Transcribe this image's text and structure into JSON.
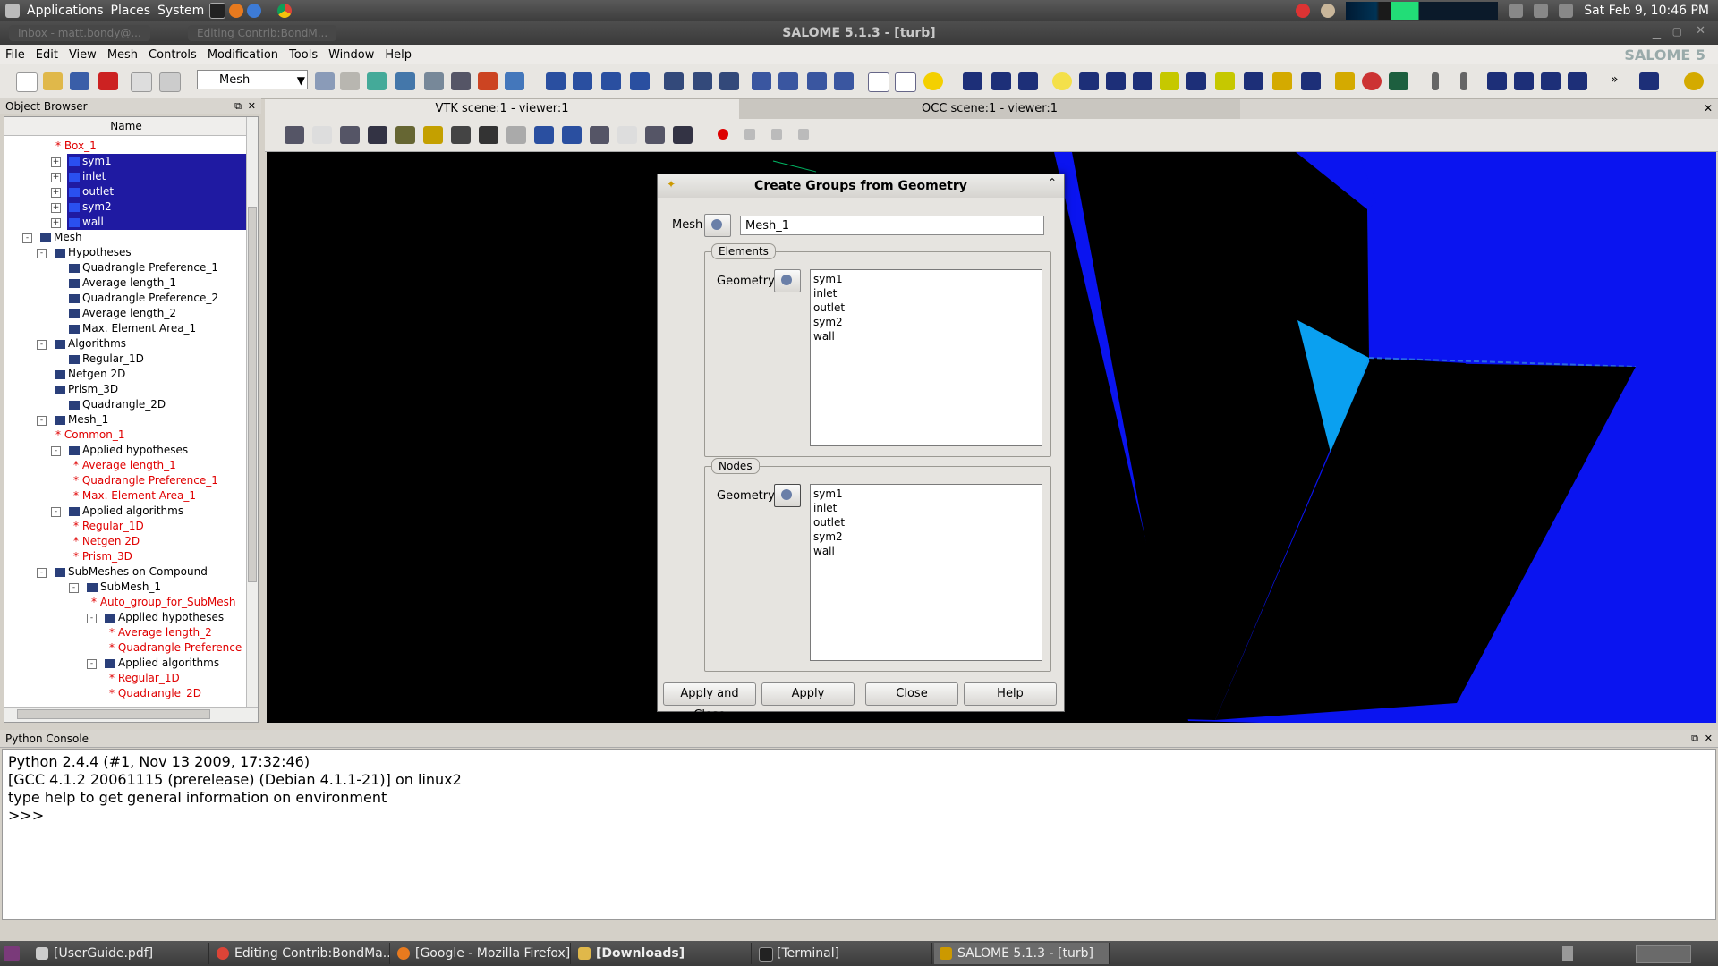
{
  "top_panel": {
    "menus": [
      "Applications",
      "Places",
      "System"
    ],
    "clock": "Sat Feb  9, 10:46 PM"
  },
  "window": {
    "title": "SALOME 5.1.3 - [turb]",
    "ghost_tabs": [
      "Inbox - matt.bondy@...",
      "Editing Contrib:BondM..."
    ]
  },
  "menubar": [
    "File",
    "Edit",
    "View",
    "Mesh",
    "Controls",
    "Modification",
    "Tools",
    "Window",
    "Help"
  ],
  "toolbar": {
    "module_combo": "Mesh"
  },
  "object_browser": {
    "title": "Object Browser",
    "column": "Name",
    "items": [
      {
        "label": "* Box_1",
        "indent": 64,
        "red": true
      },
      {
        "label": "sym1",
        "indent": 80,
        "selected": true,
        "expand": "+"
      },
      {
        "label": "inlet",
        "indent": 80,
        "selected": true,
        "expand": "+"
      },
      {
        "label": "outlet",
        "indent": 80,
        "selected": true,
        "expand": "+"
      },
      {
        "label": "sym2",
        "indent": 80,
        "selected": true,
        "expand": "+"
      },
      {
        "label": "wall",
        "indent": 80,
        "selected": true,
        "expand": "+"
      },
      {
        "label": "Mesh",
        "indent": 48,
        "expand": "-"
      },
      {
        "label": "Hypotheses",
        "indent": 64,
        "expand": "-"
      },
      {
        "label": "Quadrangle Preference_1",
        "indent": 80
      },
      {
        "label": "Average length_1",
        "indent": 80
      },
      {
        "label": "Quadrangle Preference_2",
        "indent": 80
      },
      {
        "label": "Average length_2",
        "indent": 80
      },
      {
        "label": "Max. Element Area_1",
        "indent": 80
      },
      {
        "label": "Algorithms",
        "indent": 64,
        "expand": "-"
      },
      {
        "label": "Regular_1D",
        "indent": 80
      },
      {
        "label": "Netgen 2D",
        "indent": 64
      },
      {
        "label": "Prism_3D",
        "indent": 64
      },
      {
        "label": "Quadrangle_2D",
        "indent": 80
      },
      {
        "label": "Mesh_1",
        "indent": 64,
        "expand": "-"
      },
      {
        "label": "* Common_1",
        "indent": 64,
        "red": true
      },
      {
        "label": "Applied hypotheses",
        "indent": 80,
        "expand": "-"
      },
      {
        "label": "* Average length_1",
        "indent": 84,
        "red": true
      },
      {
        "label": "* Quadrangle Preference_1",
        "indent": 84,
        "red": true
      },
      {
        "label": "* Max. Element Area_1",
        "indent": 84,
        "red": true
      },
      {
        "label": "Applied algorithms",
        "indent": 80,
        "expand": "-"
      },
      {
        "label": "* Regular_1D",
        "indent": 84,
        "red": true
      },
      {
        "label": "* Netgen 2D",
        "indent": 84,
        "red": true
      },
      {
        "label": "* Prism_3D",
        "indent": 84,
        "red": true
      },
      {
        "label": "SubMeshes on Compound",
        "indent": 64,
        "expand": "-"
      },
      {
        "label": "SubMesh_1",
        "indent": 100,
        "expand": "-"
      },
      {
        "label": "* Auto_group_for_SubMesh",
        "indent": 104,
        "red": true
      },
      {
        "label": "Applied hypotheses",
        "indent": 120,
        "expand": "-"
      },
      {
        "label": "* Average length_2",
        "indent": 124,
        "red": true
      },
      {
        "label": "* Quadrangle Preference",
        "indent": 124,
        "red": true
      },
      {
        "label": "Applied algorithms",
        "indent": 120,
        "expand": "-"
      },
      {
        "label": "* Regular_1D",
        "indent": 124,
        "red": true
      },
      {
        "label": "* Quadrangle_2D",
        "indent": 124,
        "red": true
      }
    ]
  },
  "viewer": {
    "tabs": [
      "VTK scene:1 - viewer:1",
      "OCC scene:1 - viewer:1"
    ]
  },
  "dialog": {
    "title": "Create Groups from Geometry",
    "mesh_label": "Mesh",
    "mesh_value": "Mesh_1",
    "elements_title": "Elements",
    "nodes_title": "Nodes",
    "geometry_label": "Geometry",
    "elements_list": [
      "sym1",
      "inlet",
      "outlet",
      "sym2",
      "wall"
    ],
    "nodes_list": [
      "sym1",
      "inlet",
      "outlet",
      "sym2",
      "wall"
    ],
    "buttons": {
      "apply_close": "Apply and Close",
      "apply": "Apply",
      "close": "Close",
      "help": "Help"
    }
  },
  "python_console": {
    "title": "Python Console",
    "lines": [
      "Python 2.4.4 (#1, Nov 13 2009, 17:32:46)",
      "[GCC 4.1.2 20061115 (prerelease) (Debian 4.1.1-21)] on linux2",
      "type help to get general information on environment",
      ">>>"
    ]
  },
  "taskbar": [
    "[UserGuide.pdf]",
    "Editing Contrib:BondMa...",
    "[Google - Mozilla Firefox]",
    "[Downloads]",
    "[Terminal]",
    "SALOME 5.1.3 - [turb]"
  ],
  "colors": {
    "selection": "#1f1aa2",
    "published_red": "#e00000",
    "mesh_blue": "#0a14f0"
  }
}
